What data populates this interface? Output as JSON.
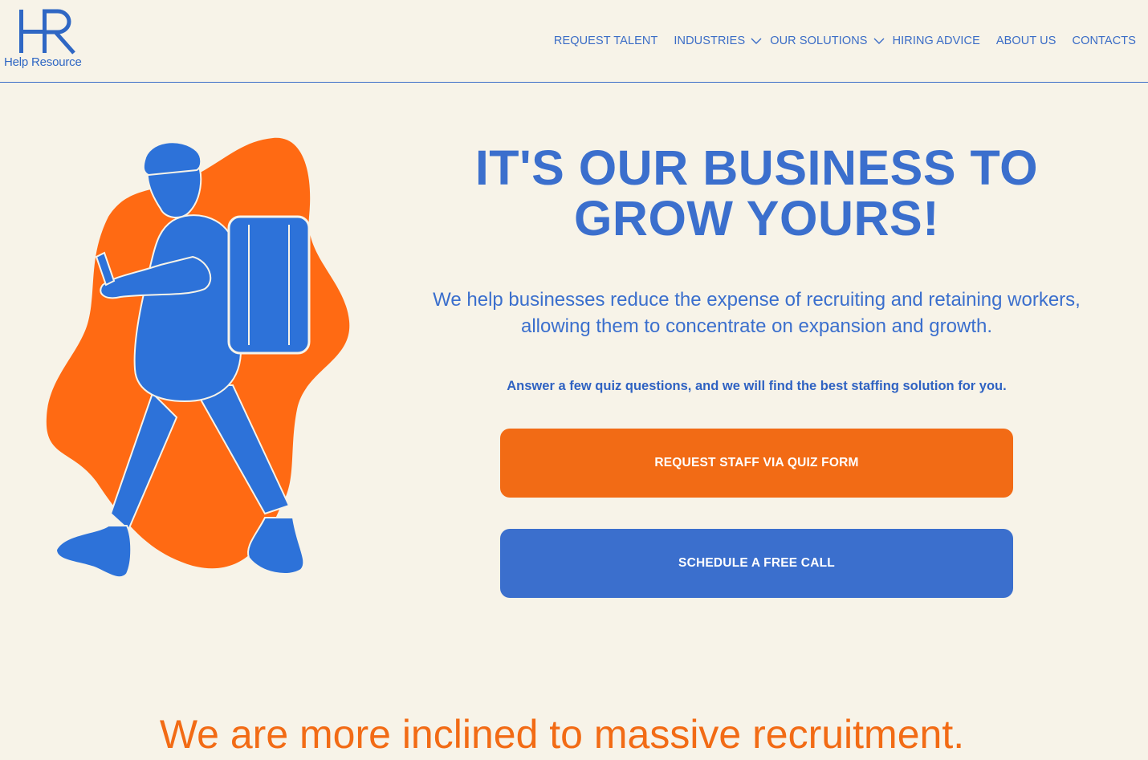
{
  "brand": {
    "logo_letters": "HR",
    "name": "Help Resource",
    "colors": {
      "primary_blue": "#3b6fcd",
      "accent_orange": "#f26b15",
      "background": "#f7f3e8"
    }
  },
  "nav": {
    "items": [
      {
        "label": "REQUEST TALENT",
        "has_dropdown": false
      },
      {
        "label": "INDUSTRIES",
        "has_dropdown": true,
        "icon": "chevron-down-icon"
      },
      {
        "label": "OUR SOLUTIONS",
        "has_dropdown": true,
        "icon": "chevron-down-icon"
      },
      {
        "label": "HIRING ADVICE",
        "has_dropdown": false
      },
      {
        "label": "ABOUT US",
        "has_dropdown": false
      },
      {
        "label": "CONTACTS",
        "has_dropdown": false
      }
    ]
  },
  "hero": {
    "illustration": "person-with-backpack-illustration",
    "headline_line1": "IT'S OUR BUSINESS TO",
    "headline_line2": "GROW YOURS!",
    "subtext_line1": "We help businesses reduce the expense of recruiting and retaining workers,",
    "subtext_line2": "allowing them to concentrate on expansion and growth.",
    "quiz_hint": "Answer a few quiz questions, and we will find the best staffing solution for you.",
    "quiz_button": "REQUEST STAFF VIA QUIZ FORM",
    "call_button": "SCHEDULE A FREE CALL"
  },
  "section2": {
    "headline": "We are more inclined to massive recruitment."
  }
}
